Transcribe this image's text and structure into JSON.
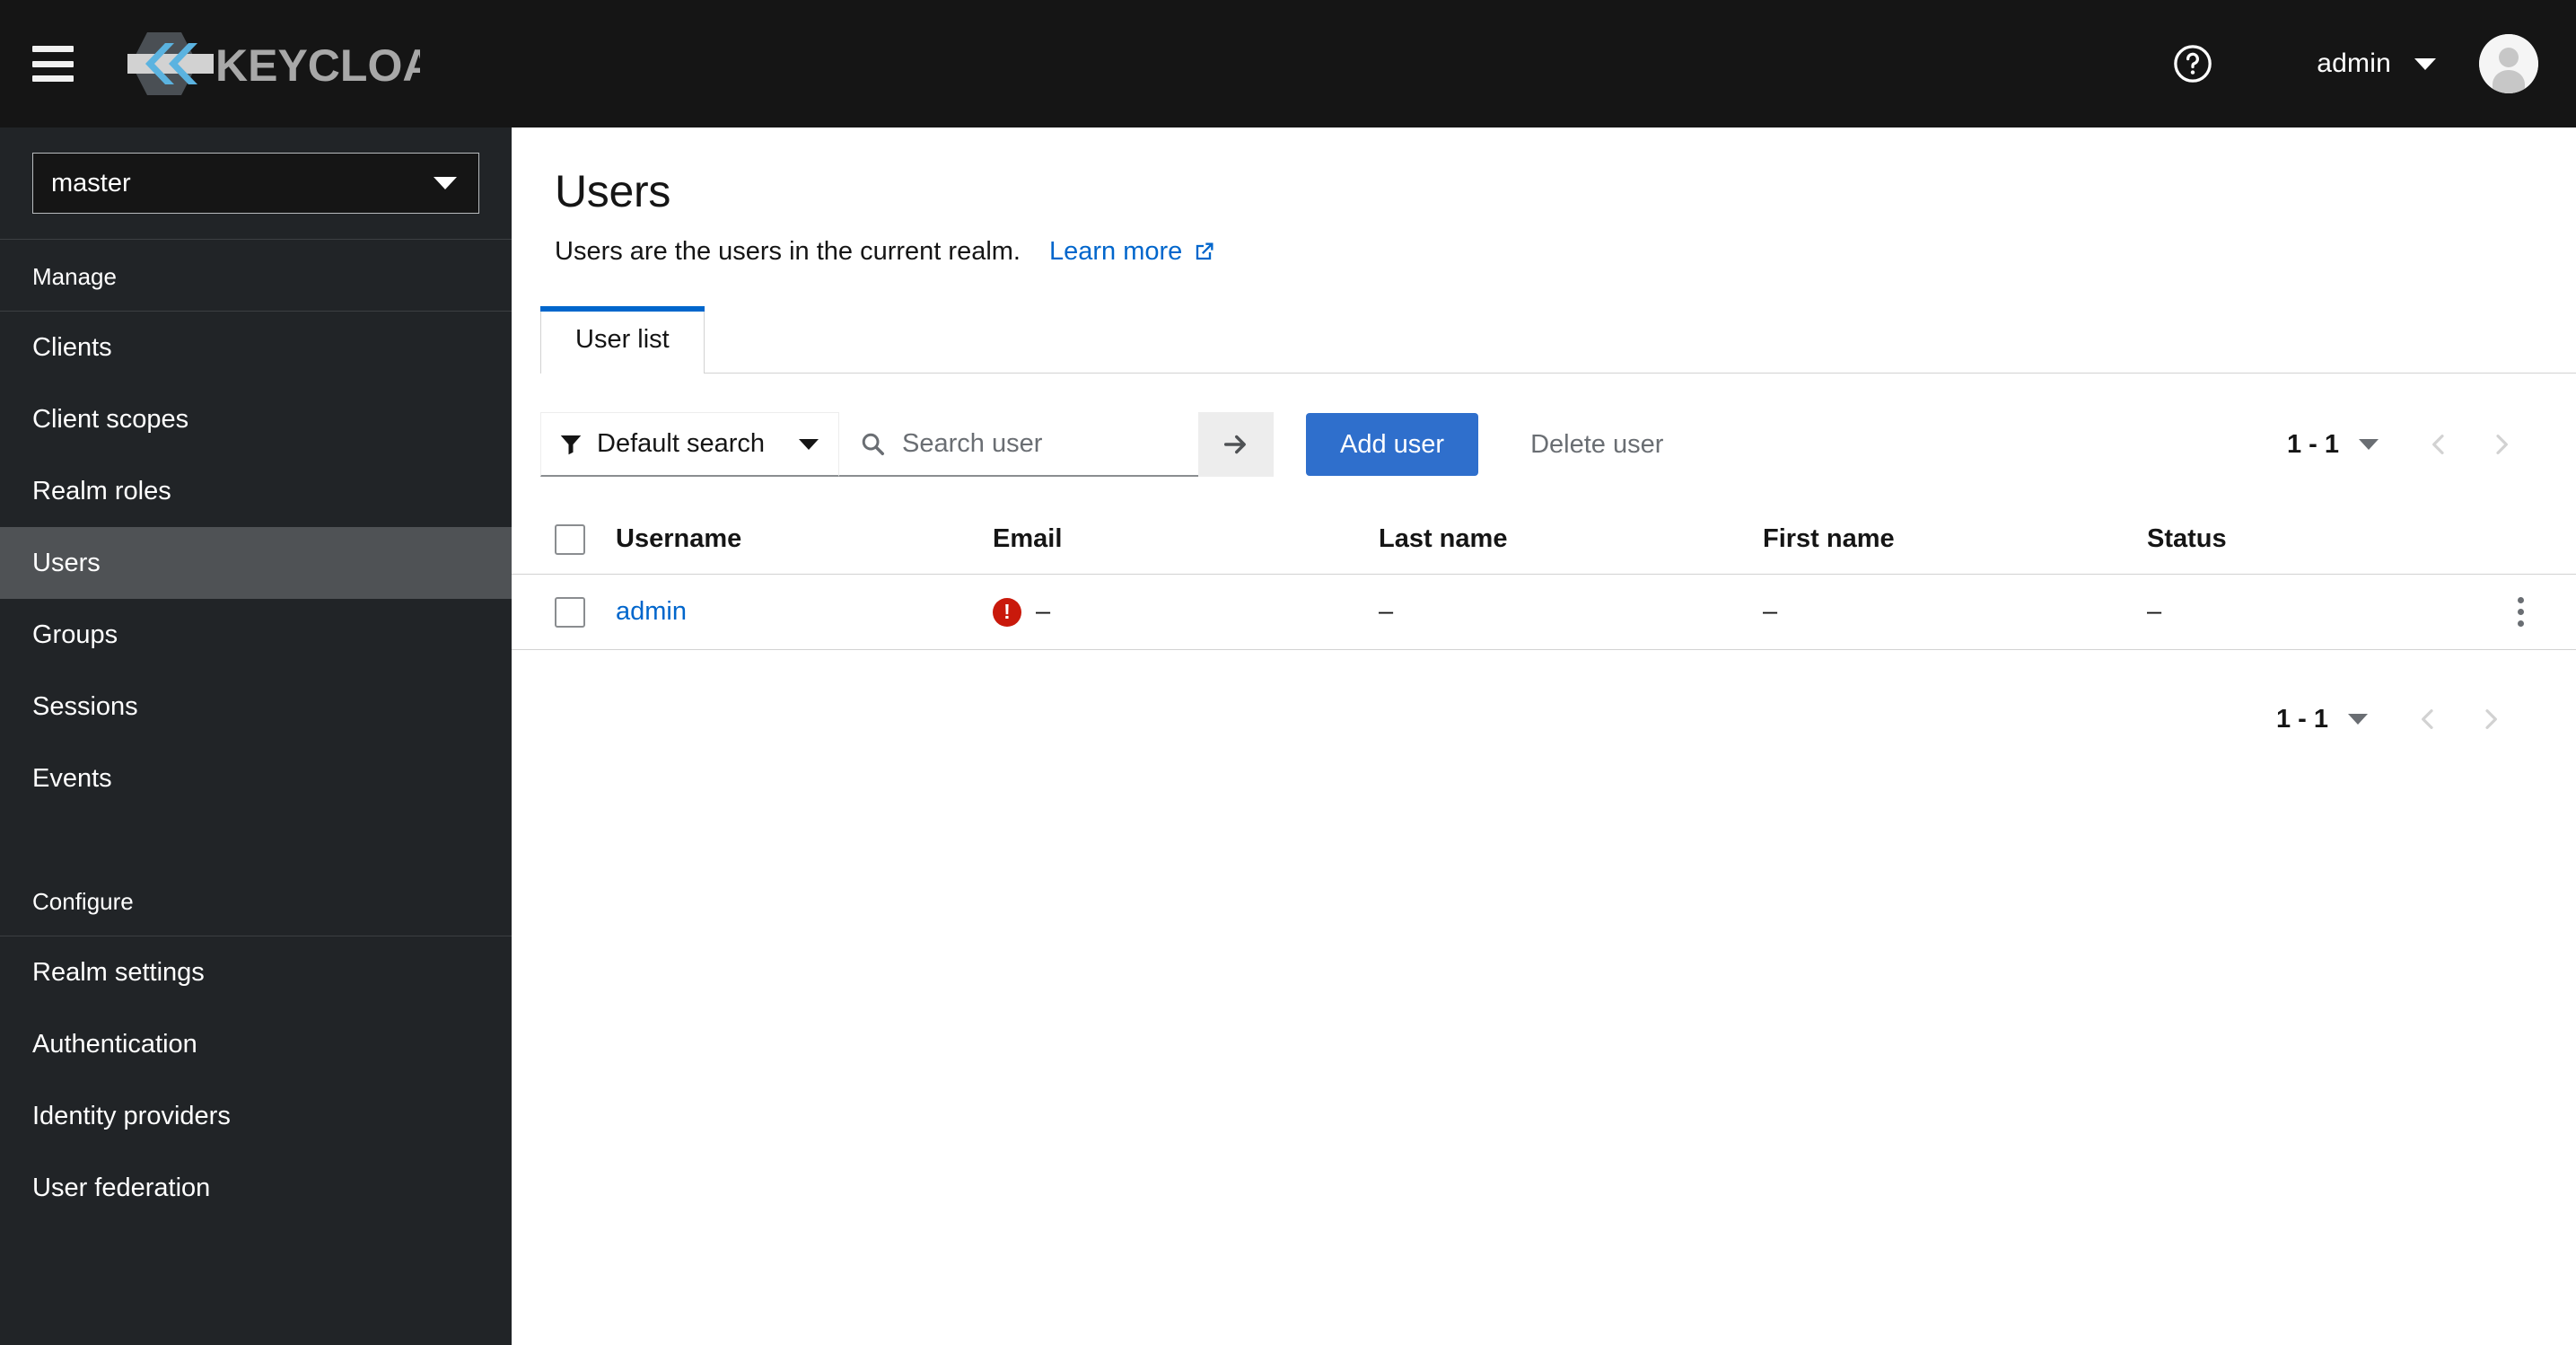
{
  "masthead": {
    "nav_toggle_label": "Global navigation",
    "brand_name": "KEYCLOAK",
    "help_label": "?",
    "user_name": "admin"
  },
  "sidebar": {
    "realm": {
      "selected": "master"
    },
    "sections": [
      {
        "title": "Manage",
        "items": [
          {
            "label": "Clients",
            "active": false
          },
          {
            "label": "Client scopes",
            "active": false
          },
          {
            "label": "Realm roles",
            "active": false
          },
          {
            "label": "Users",
            "active": true
          },
          {
            "label": "Groups",
            "active": false
          },
          {
            "label": "Sessions",
            "active": false
          },
          {
            "label": "Events",
            "active": false
          }
        ]
      },
      {
        "title": "Configure",
        "items": [
          {
            "label": "Realm settings",
            "active": false
          },
          {
            "label": "Authentication",
            "active": false
          },
          {
            "label": "Identity providers",
            "active": false
          },
          {
            "label": "User federation",
            "active": false
          }
        ]
      }
    ]
  },
  "page": {
    "title": "Users",
    "subtitle": "Users are the users in the current realm.",
    "learn_more": "Learn more"
  },
  "tabs": [
    {
      "label": "User list",
      "active": true
    }
  ],
  "toolbar": {
    "filter_label": "Default search",
    "search_placeholder": "Search user",
    "search_value": "",
    "add_user_label": "Add user",
    "delete_user_label": "Delete user"
  },
  "pagination": {
    "range": "1 - 1"
  },
  "table": {
    "columns": [
      "Username",
      "Email",
      "Last name",
      "First name",
      "Status"
    ],
    "rows": [
      {
        "username": "admin",
        "email": "–",
        "email_warning": "!",
        "last_name": "–",
        "first_name": "–",
        "status": "–"
      }
    ]
  },
  "colors": {
    "accent_blue": "#0066cc",
    "button_blue": "#2f6fcc",
    "danger_red": "#c9190b",
    "masthead_bg": "#151515",
    "sidebar_bg": "#212427",
    "sidebar_active": "#4f5255"
  }
}
